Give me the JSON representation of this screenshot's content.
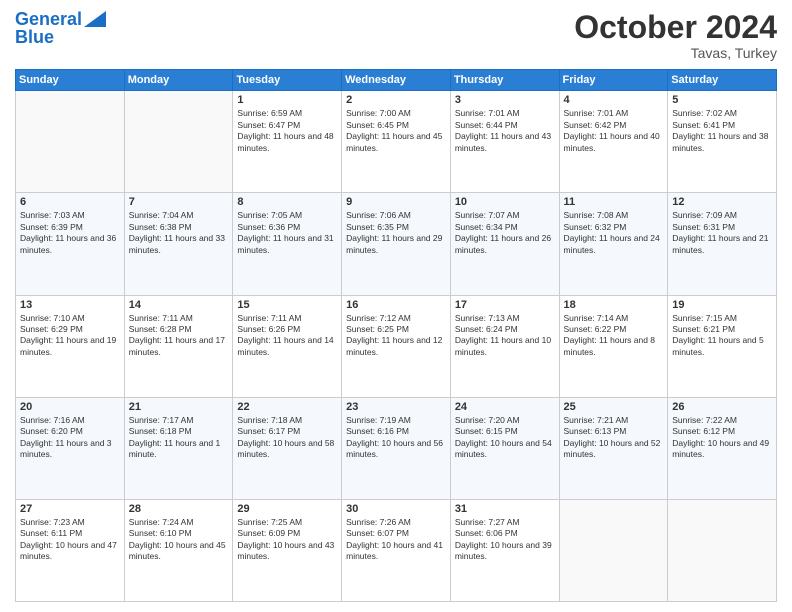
{
  "logo": {
    "line1": "General",
    "line2": "Blue"
  },
  "title": "October 2024",
  "location": "Tavas, Turkey",
  "days_header": [
    "Sunday",
    "Monday",
    "Tuesday",
    "Wednesday",
    "Thursday",
    "Friday",
    "Saturday"
  ],
  "weeks": [
    [
      {
        "day": "",
        "info": ""
      },
      {
        "day": "",
        "info": ""
      },
      {
        "day": "1",
        "info": "Sunrise: 6:59 AM\nSunset: 6:47 PM\nDaylight: 11 hours and 48 minutes."
      },
      {
        "day": "2",
        "info": "Sunrise: 7:00 AM\nSunset: 6:45 PM\nDaylight: 11 hours and 45 minutes."
      },
      {
        "day": "3",
        "info": "Sunrise: 7:01 AM\nSunset: 6:44 PM\nDaylight: 11 hours and 43 minutes."
      },
      {
        "day": "4",
        "info": "Sunrise: 7:01 AM\nSunset: 6:42 PM\nDaylight: 11 hours and 40 minutes."
      },
      {
        "day": "5",
        "info": "Sunrise: 7:02 AM\nSunset: 6:41 PM\nDaylight: 11 hours and 38 minutes."
      }
    ],
    [
      {
        "day": "6",
        "info": "Sunrise: 7:03 AM\nSunset: 6:39 PM\nDaylight: 11 hours and 36 minutes."
      },
      {
        "day": "7",
        "info": "Sunrise: 7:04 AM\nSunset: 6:38 PM\nDaylight: 11 hours and 33 minutes."
      },
      {
        "day": "8",
        "info": "Sunrise: 7:05 AM\nSunset: 6:36 PM\nDaylight: 11 hours and 31 minutes."
      },
      {
        "day": "9",
        "info": "Sunrise: 7:06 AM\nSunset: 6:35 PM\nDaylight: 11 hours and 29 minutes."
      },
      {
        "day": "10",
        "info": "Sunrise: 7:07 AM\nSunset: 6:34 PM\nDaylight: 11 hours and 26 minutes."
      },
      {
        "day": "11",
        "info": "Sunrise: 7:08 AM\nSunset: 6:32 PM\nDaylight: 11 hours and 24 minutes."
      },
      {
        "day": "12",
        "info": "Sunrise: 7:09 AM\nSunset: 6:31 PM\nDaylight: 11 hours and 21 minutes."
      }
    ],
    [
      {
        "day": "13",
        "info": "Sunrise: 7:10 AM\nSunset: 6:29 PM\nDaylight: 11 hours and 19 minutes."
      },
      {
        "day": "14",
        "info": "Sunrise: 7:11 AM\nSunset: 6:28 PM\nDaylight: 11 hours and 17 minutes."
      },
      {
        "day": "15",
        "info": "Sunrise: 7:11 AM\nSunset: 6:26 PM\nDaylight: 11 hours and 14 minutes."
      },
      {
        "day": "16",
        "info": "Sunrise: 7:12 AM\nSunset: 6:25 PM\nDaylight: 11 hours and 12 minutes."
      },
      {
        "day": "17",
        "info": "Sunrise: 7:13 AM\nSunset: 6:24 PM\nDaylight: 11 hours and 10 minutes."
      },
      {
        "day": "18",
        "info": "Sunrise: 7:14 AM\nSunset: 6:22 PM\nDaylight: 11 hours and 8 minutes."
      },
      {
        "day": "19",
        "info": "Sunrise: 7:15 AM\nSunset: 6:21 PM\nDaylight: 11 hours and 5 minutes."
      }
    ],
    [
      {
        "day": "20",
        "info": "Sunrise: 7:16 AM\nSunset: 6:20 PM\nDaylight: 11 hours and 3 minutes."
      },
      {
        "day": "21",
        "info": "Sunrise: 7:17 AM\nSunset: 6:18 PM\nDaylight: 11 hours and 1 minute."
      },
      {
        "day": "22",
        "info": "Sunrise: 7:18 AM\nSunset: 6:17 PM\nDaylight: 10 hours and 58 minutes."
      },
      {
        "day": "23",
        "info": "Sunrise: 7:19 AM\nSunset: 6:16 PM\nDaylight: 10 hours and 56 minutes."
      },
      {
        "day": "24",
        "info": "Sunrise: 7:20 AM\nSunset: 6:15 PM\nDaylight: 10 hours and 54 minutes."
      },
      {
        "day": "25",
        "info": "Sunrise: 7:21 AM\nSunset: 6:13 PM\nDaylight: 10 hours and 52 minutes."
      },
      {
        "day": "26",
        "info": "Sunrise: 7:22 AM\nSunset: 6:12 PM\nDaylight: 10 hours and 49 minutes."
      }
    ],
    [
      {
        "day": "27",
        "info": "Sunrise: 7:23 AM\nSunset: 6:11 PM\nDaylight: 10 hours and 47 minutes."
      },
      {
        "day": "28",
        "info": "Sunrise: 7:24 AM\nSunset: 6:10 PM\nDaylight: 10 hours and 45 minutes."
      },
      {
        "day": "29",
        "info": "Sunrise: 7:25 AM\nSunset: 6:09 PM\nDaylight: 10 hours and 43 minutes."
      },
      {
        "day": "30",
        "info": "Sunrise: 7:26 AM\nSunset: 6:07 PM\nDaylight: 10 hours and 41 minutes."
      },
      {
        "day": "31",
        "info": "Sunrise: 7:27 AM\nSunset: 6:06 PM\nDaylight: 10 hours and 39 minutes."
      },
      {
        "day": "",
        "info": ""
      },
      {
        "day": "",
        "info": ""
      }
    ]
  ]
}
